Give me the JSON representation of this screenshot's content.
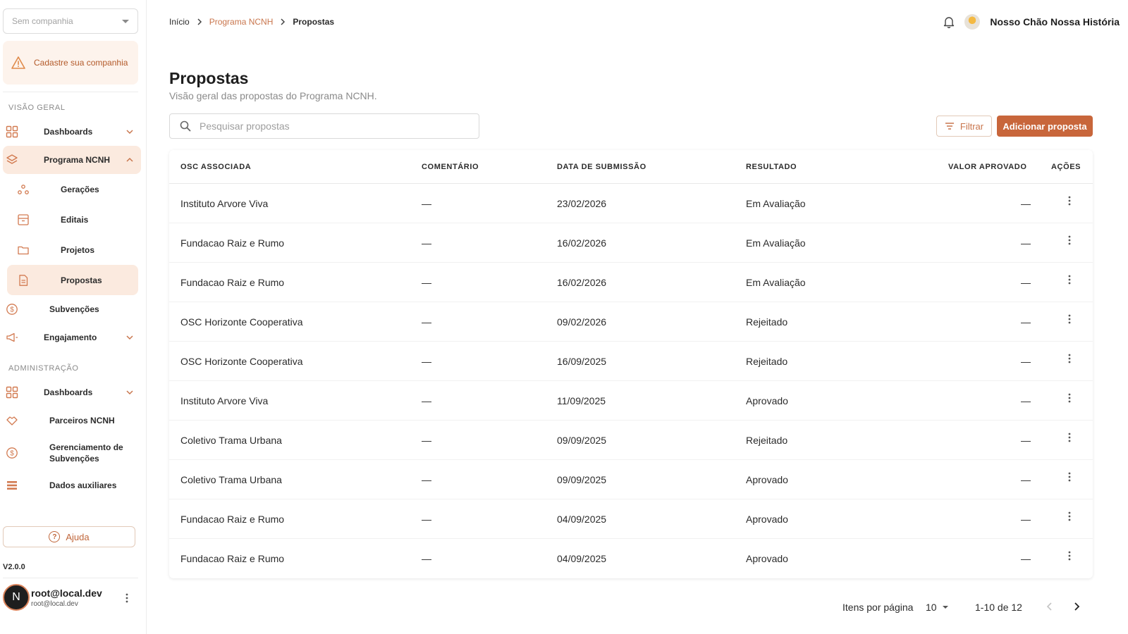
{
  "colors": {
    "accent": "#c8663b",
    "accent_light": "#fbeadf",
    "link": "#c9764d"
  },
  "sidebar": {
    "company_placeholder": "Sem companhia",
    "alert_text": "Cadastre sua companhia",
    "sections": {
      "overview": "VISÃO GERAL",
      "admin": "ADMINISTRAÇÃO"
    },
    "items": {
      "dashboards": "Dashboards",
      "programa": "Programa NCNH",
      "geracoes": "Gerações",
      "editais": "Editais",
      "projetos": "Projetos",
      "propostas": "Propostas",
      "subvencoes": "Subvenções",
      "engajamento": "Engajamento",
      "admin_dashboards": "Dashboards",
      "parceiros": "Parceiros NCNH",
      "gerenciamento": "Gerenciamento de Subvenções",
      "dados": "Dados auxiliares"
    },
    "help": "Ajuda",
    "version": "V2.0.0",
    "user": {
      "initial": "N",
      "name": "root@local.dev",
      "email": "root@local.dev"
    }
  },
  "header": {
    "breadcrumb": {
      "home": "Início",
      "program": "Programa NCNH",
      "current": "Propostas"
    },
    "org_name": "Nosso Chão Nossa História"
  },
  "page": {
    "title": "Propostas",
    "subtitle": "Visão geral das propostas do Programa NCNH.",
    "search_placeholder": "Pesquisar propostas",
    "filter_label": "Filtrar",
    "add_label": "Adicionar proposta"
  },
  "table": {
    "headers": {
      "osc": "OSC ASSOCIADA",
      "comentario": "COMENTÁRIO",
      "data": "DATA DE SUBMISSÃO",
      "resultado": "RESULTADO",
      "valor": "VALOR APROVADO",
      "acoes": "AÇÕES"
    },
    "rows": [
      {
        "osc": "Instituto Arvore Viva",
        "comentario": "—",
        "data": "23/02/2026",
        "resultado": "Em Avaliação",
        "valor": "—"
      },
      {
        "osc": "Fundacao Raiz e Rumo",
        "comentario": "—",
        "data": "16/02/2026",
        "resultado": "Em Avaliação",
        "valor": "—"
      },
      {
        "osc": "Fundacao Raiz e Rumo",
        "comentario": "—",
        "data": "16/02/2026",
        "resultado": "Em Avaliação",
        "valor": "—"
      },
      {
        "osc": "OSC Horizonte Cooperativa",
        "comentario": "—",
        "data": "09/02/2026",
        "resultado": "Rejeitado",
        "valor": "—"
      },
      {
        "osc": "OSC Horizonte Cooperativa",
        "comentario": "—",
        "data": "16/09/2025",
        "resultado": "Rejeitado",
        "valor": "—"
      },
      {
        "osc": "Instituto Arvore Viva",
        "comentario": "—",
        "data": "11/09/2025",
        "resultado": "Aprovado",
        "valor": "—"
      },
      {
        "osc": "Coletivo Trama Urbana",
        "comentario": "—",
        "data": "09/09/2025",
        "resultado": "Rejeitado",
        "valor": "—"
      },
      {
        "osc": "Coletivo Trama Urbana",
        "comentario": "—",
        "data": "09/09/2025",
        "resultado": "Aprovado",
        "valor": "—"
      },
      {
        "osc": "Fundacao Raiz e Rumo",
        "comentario": "—",
        "data": "04/09/2025",
        "resultado": "Aprovado",
        "valor": "—"
      },
      {
        "osc": "Fundacao Raiz e Rumo",
        "comentario": "—",
        "data": "04/09/2025",
        "resultado": "Aprovado",
        "valor": "—"
      }
    ]
  },
  "pagination": {
    "per_page_label": "Itens por página",
    "per_page_value": "10",
    "range": "1-10 de 12"
  }
}
